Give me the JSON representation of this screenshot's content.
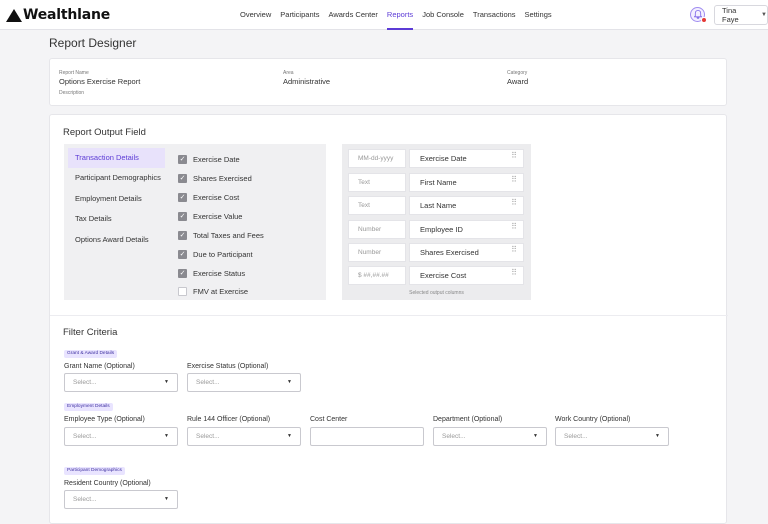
{
  "brand": {
    "name": "Wealthlane"
  },
  "nav": {
    "items": [
      "Overview",
      "Participants",
      "Awards Center",
      "Reports",
      "Job Console",
      "Transactions",
      "Settings"
    ],
    "active": "Reports"
  },
  "user": {
    "name": "Tina Faye"
  },
  "page": {
    "title": "Report Designer"
  },
  "meta": {
    "report_name_label": "Report Name",
    "report_name": "Options Exercise Report",
    "description_label": "Description",
    "area_label": "Area",
    "area": "Administrative",
    "category_label": "Category",
    "category": "Award"
  },
  "output": {
    "title": "Report Output Field",
    "categories": [
      "Transaction Details",
      "Participant Demographics",
      "Employment Details",
      "Tax Details",
      "Options Award Details"
    ],
    "active_category": "Transaction Details",
    "fields": [
      {
        "label": "Exercise Date",
        "checked": true
      },
      {
        "label": "Shares Exercised",
        "checked": true
      },
      {
        "label": "Exercise Cost",
        "checked": true
      },
      {
        "label": "Exercise Value",
        "checked": true
      },
      {
        "label": "Total Taxes and Fees",
        "checked": true
      },
      {
        "label": "Due to Participant",
        "checked": true
      },
      {
        "label": "Exercise Status",
        "checked": true
      },
      {
        "label": "FMV at Exercise",
        "checked": false
      }
    ],
    "selected": [
      {
        "format": "MM-dd-yyyy",
        "name": "Exercise Date"
      },
      {
        "format": "Text",
        "name": "First Name"
      },
      {
        "format": "Text",
        "name": "Last Name"
      },
      {
        "format": "Number",
        "name": "Employee ID"
      },
      {
        "format": "Number",
        "name": "Shares Exercised"
      },
      {
        "format": "$ ##,##.##",
        "name": "Exercise Cost"
      }
    ],
    "selected_caption": "Selected output columns"
  },
  "filter": {
    "title": "Filter Criteria",
    "groups": [
      {
        "tag": "Grant & Award Details",
        "fields": [
          {
            "label": "Grant Name (Optional)",
            "type": "select",
            "placeholder": "Select..."
          },
          {
            "label": "Exercise Status (Optional)",
            "type": "select",
            "placeholder": "Select..."
          }
        ]
      },
      {
        "tag": "Employment Details",
        "fields": [
          {
            "label": "Employee Type (Optional)",
            "type": "select",
            "placeholder": "Select..."
          },
          {
            "label": "Rule 144 Officer (Optional)",
            "type": "select",
            "placeholder": "Select..."
          },
          {
            "label": "Cost Center",
            "type": "text",
            "placeholder": ""
          },
          {
            "label": "Department (Optional)",
            "type": "select",
            "placeholder": "Select..."
          },
          {
            "label": "Work Country (Optional)",
            "type": "select",
            "placeholder": "Select..."
          }
        ]
      },
      {
        "tag": "Participant Demographics",
        "fields": [
          {
            "label": "Resident Country (Optional)",
            "type": "select",
            "placeholder": "Select..."
          }
        ]
      }
    ]
  }
}
